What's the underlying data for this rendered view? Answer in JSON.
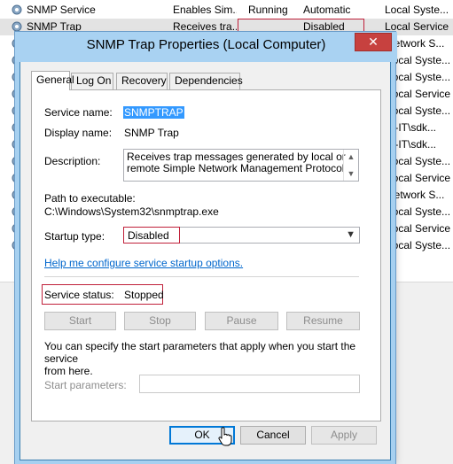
{
  "services": [
    {
      "name": "SNMP Service",
      "description": "Enables Sim...",
      "status": "Running",
      "startup": "Automatic",
      "logon": "Local Syste..."
    },
    {
      "name": "SNMP Trap",
      "description": "Receives tra...",
      "status": "",
      "startup": "Disabled",
      "logon": "Local Service"
    }
  ],
  "bg_logon_column": [
    "Network S...",
    "Local Syste...",
    "Local Syste...",
    "Local Service",
    "Local Syste...",
    "O-IT\\sdk...",
    "O-IT\\sdk...",
    "Local Syste...",
    "Local Service",
    "Network S...",
    "Local Syste...",
    "Local Service",
    "Local Syste..."
  ],
  "dialog": {
    "title": "SNMP Trap Properties (Local Computer)",
    "close_glyph": "✕",
    "tabs": [
      "General",
      "Log On",
      "Recovery",
      "Dependencies"
    ],
    "service_name_label": "Service name:",
    "service_name": "SNMPTRAP",
    "display_name_label": "Display name:",
    "display_name": "SNMP Trap",
    "description_label": "Description:",
    "description_line1": "Receives trap messages generated by local or",
    "description_line2": "remote Simple Network Management Protocol",
    "path_label": "Path to executable:",
    "path": "C:\\Windows\\System32\\snmptrap.exe",
    "startup_type_label": "Startup type:",
    "startup_type": "Disabled",
    "help_link": "Help me configure service startup options.",
    "service_status_label": "Service status:",
    "service_status": "Stopped",
    "buttons": {
      "start": "Start",
      "stop": "Stop",
      "pause": "Pause",
      "resume": "Resume"
    },
    "params_help_line1": "You can specify the start parameters that apply when you start the service",
    "params_help_line2": "from here.",
    "start_params_label": "Start parameters:",
    "start_params_value": "",
    "footer": {
      "ok": "OK",
      "cancel": "Cancel",
      "apply": "Apply"
    }
  },
  "colors": {
    "highlight": "#c0203a",
    "titlebar": "#a9d2f2",
    "selection": "#3399ff",
    "link": "#0066cc"
  }
}
